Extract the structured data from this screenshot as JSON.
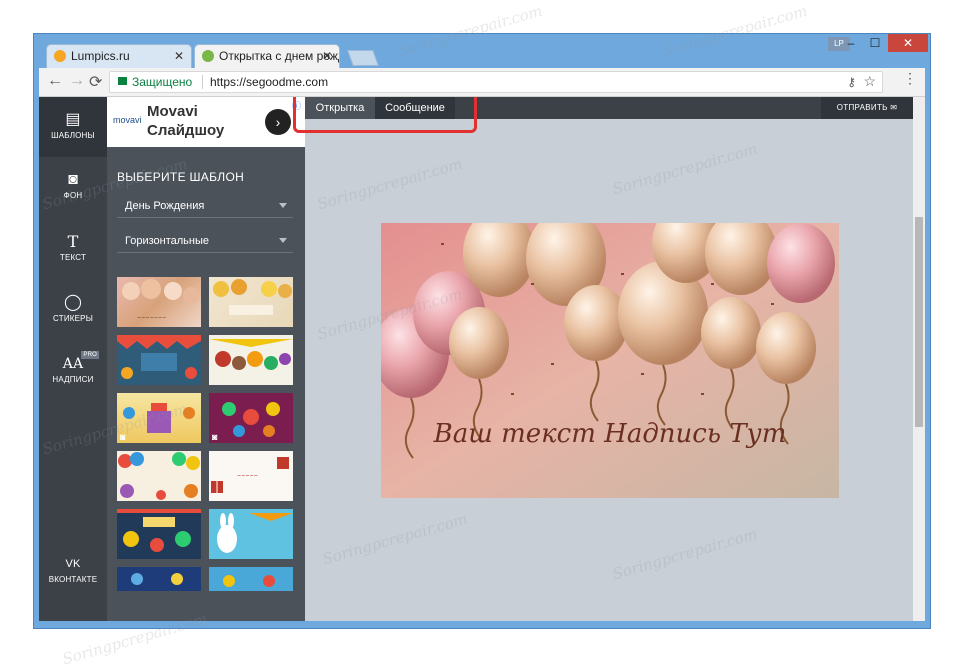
{
  "browser": {
    "tabs": [
      {
        "title": "Lumpics.ru",
        "close": "✕"
      },
      {
        "title": "Открытка с днем рожде",
        "close": "✕"
      }
    ],
    "profile_badge": "LP",
    "window_controls": {
      "minimize": "–",
      "maximize": "☐",
      "close": "✕"
    },
    "nav": {
      "back": "←",
      "forward": "→",
      "reload": "⟳"
    },
    "address": {
      "secure_label": "Защищено",
      "url": "https://segoodme.com"
    },
    "icons": {
      "key": "key-icon",
      "star": "star-icon",
      "menu": "menu-dots-icon"
    }
  },
  "left_nav": [
    {
      "label": "ШАБЛОНЫ",
      "icon": "template-icon",
      "glyph": "▤"
    },
    {
      "label": "ФОН",
      "icon": "background-icon",
      "glyph": "◙"
    },
    {
      "label": "ТЕКСТ",
      "icon": "text-icon",
      "glyph": "T"
    },
    {
      "label": "СТИКЕРЫ",
      "icon": "sticker-icon",
      "glyph": "◯"
    },
    {
      "label": "НАДПИСИ",
      "icon": "lettering-icon",
      "glyph": "AA",
      "badge": "PRO"
    },
    {
      "label": "ВКОНТАКТЕ",
      "icon": "vk-icon",
      "glyph": "VK"
    }
  ],
  "ad": {
    "brand": "movavi",
    "title_line1": "Movavi",
    "title_line2": "Слайдшоу",
    "button": "›"
  },
  "panel": {
    "title": "ВЫБЕРИТЕ ШАБЛОН",
    "category_select": "День Рождения",
    "orientation_select": "Горизонтальные"
  },
  "editor": {
    "tab_card": "Открытка",
    "tab_message": "Сообщение",
    "send_label": "ОТПРАВИТЬ"
  },
  "card": {
    "text": "Ваш текст Надпись Тут"
  },
  "watermark": "Soringpcrepair.com",
  "colors": {
    "window_frame": "#6fa8dc",
    "sidebar_dark": "#3c4148",
    "panel": "#4b525a",
    "canvas_bg": "#c9cfd7",
    "highlight": "#e03030",
    "secure_green": "#0b8043"
  }
}
